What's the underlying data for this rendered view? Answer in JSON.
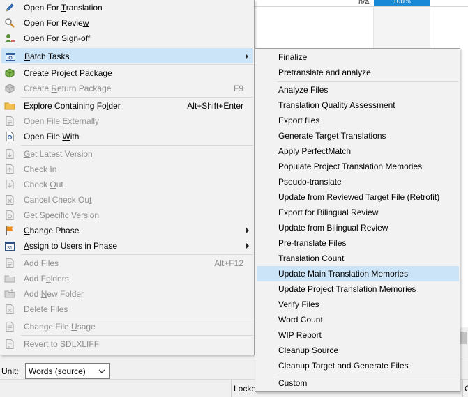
{
  "background": {
    "na_text": "n/a",
    "progress_text": "100%",
    "unit_label": "Unit:",
    "unit_value": "Words (source)",
    "status_locked": "Locke",
    "status_right": "C"
  },
  "menu": {
    "open_for_translation": {
      "pre": "Open For ",
      "u": "T",
      "post": "ranslation"
    },
    "open_for_review": {
      "pre": "Open For Revie",
      "u": "w",
      "post": ""
    },
    "open_for_signoff": {
      "pre": "Open For S",
      "u": "i",
      "post": "gn-off"
    },
    "batch_tasks": {
      "pre": "",
      "u": "B",
      "post": "atch Tasks"
    },
    "create_project_package": {
      "pre": "Create ",
      "u": "P",
      "post": "roject Package"
    },
    "create_return_package": {
      "pre": "Create ",
      "u": "R",
      "post": "eturn Package",
      "shortcut": "F9"
    },
    "explore_folder": {
      "pre": "Explore Containing Fo",
      "u": "l",
      "post": "der",
      "shortcut": "Alt+Shift+Enter"
    },
    "open_externally": {
      "pre": "Open File ",
      "u": "E",
      "post": "xternally"
    },
    "open_file_with": {
      "pre": "Open File ",
      "u": "W",
      "post": "ith"
    },
    "get_latest_version": {
      "pre": "",
      "u": "G",
      "post": "et Latest Version"
    },
    "check_in": {
      "pre": "Check ",
      "u": "I",
      "post": "n"
    },
    "check_out": {
      "pre": "Check ",
      "u": "O",
      "post": "ut"
    },
    "cancel_check_out": {
      "pre": "Cancel Check Ou",
      "u": "t",
      "post": ""
    },
    "get_specific_version": {
      "pre": "Get ",
      "u": "S",
      "post": "pecific Version"
    },
    "change_phase": {
      "pre": "",
      "u": "C",
      "post": "hange Phase"
    },
    "assign_users": {
      "pre": "",
      "u": "A",
      "post": "ssign to Users in Phase"
    },
    "add_files": {
      "pre": "Add ",
      "u": "F",
      "post": "iles",
      "shortcut": "Alt+F12"
    },
    "add_folders": {
      "pre": "Add F",
      "u": "o",
      "post": "lders"
    },
    "add_new_folder": {
      "pre": "Add ",
      "u": "N",
      "post": "ew Folder"
    },
    "delete_files": {
      "pre": "",
      "u": "D",
      "post": "elete Files"
    },
    "change_file_usage": {
      "pre": "Change File ",
      "u": "U",
      "post": "sage"
    },
    "revert_sdlxliff": {
      "pre": "Revert to SDLXLIFF",
      "u": "",
      "post": ""
    }
  },
  "submenu": [
    "Finalize",
    "Pretranslate and analyze",
    "Analyze Files",
    "Translation Quality Assessment",
    "Export files",
    "Generate Target Translations",
    "Apply PerfectMatch",
    "Populate Project Translation Memories",
    "Pseudo-translate",
    "Update from Reviewed Target File (Retrofit)",
    "Export for Bilingual Review",
    "Update from Bilingual Review",
    "Pre-translate Files",
    "Translation Count",
    "Update Main Translation Memories",
    "Update Project Translation Memories",
    "Verify Files",
    "Word Count",
    "WIP Report",
    "Cleanup Source",
    "Cleanup Target and Generate Files",
    "Custom"
  ],
  "colors": {
    "highlight": "#cce4f7",
    "disabled_text": "#8d8d8d",
    "progress": "#1789d6"
  }
}
